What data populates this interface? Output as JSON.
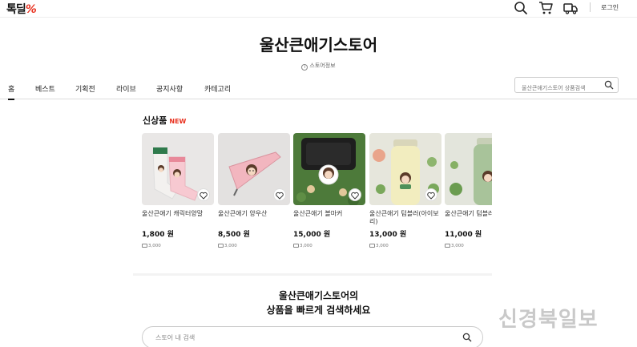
{
  "header": {
    "logo_text": "톡딜",
    "logo_mark": "%",
    "icons": [
      "search-icon",
      "cart-icon",
      "delivery-truck-icon"
    ],
    "login_label": "로그인"
  },
  "store": {
    "title": "울산큰애기스토어",
    "info_label": "스토어정보"
  },
  "tabs": [
    {
      "label": "홈",
      "active": true
    },
    {
      "label": "베스트"
    },
    {
      "label": "기획전"
    },
    {
      "label": "라이브"
    },
    {
      "label": "공지사항"
    },
    {
      "label": "카테고리"
    }
  ],
  "store_search": {
    "placeholder": "울산큰애기스토어 상품검색"
  },
  "new_products": {
    "title": "신상품",
    "badge": "NEW",
    "items": [
      {
        "name": "울산큰애기 캐릭터양말",
        "price": "1,800 원",
        "shipping": "3,000"
      },
      {
        "name": "울산큰애기 양우산",
        "price": "8,500 원",
        "shipping": "3,000"
      },
      {
        "name": "울산큰애기 볼마커",
        "price": "15,000 원",
        "shipping": "3,000"
      },
      {
        "name": "울산큰애기 텀블러(아이보리)",
        "price": "13,000 원",
        "shipping": "3,000"
      },
      {
        "name": "울산큰애기 텀블러(그린)",
        "price": "11,000 원",
        "shipping": "3,000"
      }
    ]
  },
  "bottom_search": {
    "line1": "울산큰애기스토어의",
    "line2": "상품을 빠르게 검색하세요",
    "placeholder": "스토어 내 검색"
  },
  "watermark": "신경북일보",
  "colors": {
    "accent_red": "#e8311f",
    "text": "#111111",
    "border": "#dddddd"
  }
}
